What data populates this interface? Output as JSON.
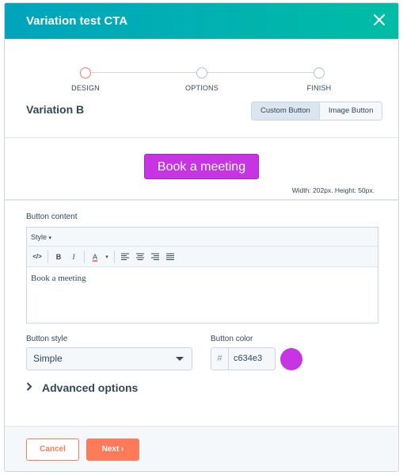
{
  "header": {
    "title": "Variation test CTA"
  },
  "stepper": {
    "steps": [
      {
        "label": "DESIGN",
        "active": true
      },
      {
        "label": "OPTIONS",
        "active": false
      },
      {
        "label": "FINISH",
        "active": false
      }
    ]
  },
  "variation": {
    "title": "Variation B",
    "toggle": {
      "options": [
        "Custom Button",
        "Image Button"
      ],
      "selected": "Custom Button"
    }
  },
  "preview": {
    "button_text": "Book a meeting",
    "dimensions": "Width: 202px. Height: 50px."
  },
  "content": {
    "label": "Button content",
    "style_menu": "Style",
    "text": "Book a meeting"
  },
  "style": {
    "label": "Button style",
    "value": "Simple"
  },
  "color": {
    "label": "Button color",
    "prefix": "#",
    "value": "c634e3",
    "swatch": "#c634e3"
  },
  "advanced": {
    "label": "Advanced options"
  },
  "footer": {
    "cancel": "Cancel",
    "next": "Next ›"
  },
  "colors": {
    "accent": "#ff7a59",
    "header": "#00a4bd",
    "cta": "#c634e3"
  }
}
